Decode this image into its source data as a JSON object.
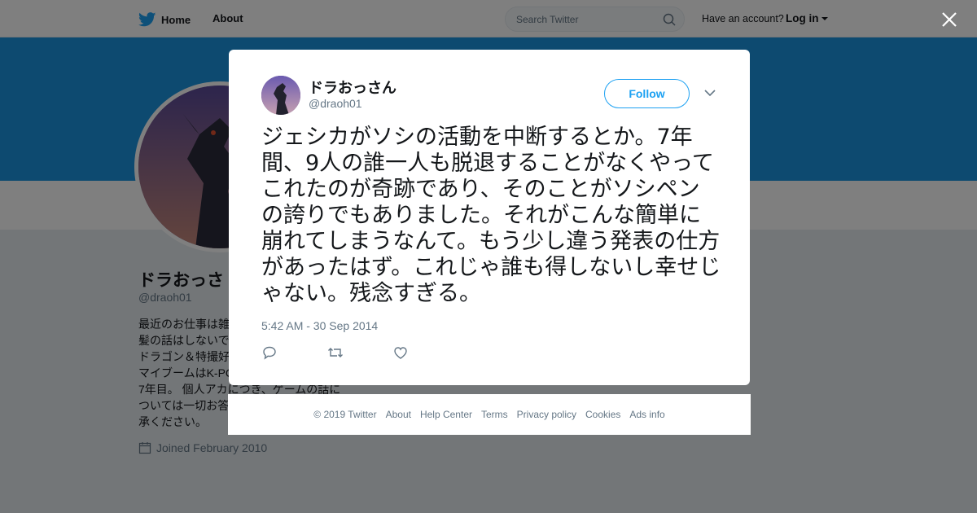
{
  "nav": {
    "home_label": "Home",
    "about_label": "About",
    "search_placeholder": "Search Twitter",
    "have_account_label": "Have an account?",
    "login_label": "Log in"
  },
  "profile": {
    "name": "ドラおっさ",
    "handle": "@draoh01",
    "bio": "最近のお仕事は雑\n髪の話はしないで\nドラゴン＆特撮好\nマイブームはK-PC\n7年目。 個人アカにつき、ゲームの話に\nついては一切お答\n承ください。",
    "joined": "Joined February 2010"
  },
  "tweet": {
    "name": "ドラおっさん",
    "handle": "@draoh01",
    "follow_label": "Follow",
    "text": "ジェシカがソシの活動を中断するとか。7年間、9人の誰一人も脱退することがなくやってこれたのが奇跡であり、そのことがソシペンの誇りでもありました。それがこんな簡単に崩れてしまうなんて。もう少し違う発表の仕方があったはず。これじゃ誰も得しないし幸せじゃない。残念すぎる。",
    "timestamp": "5:42 AM - 30 Sep 2014"
  },
  "footer": {
    "copyright": "© 2019 Twitter",
    "about": "About",
    "help": "Help Center",
    "terms": "Terms",
    "privacy": "Privacy policy",
    "cookies": "Cookies",
    "ads": "Ads info"
  },
  "icons": {
    "logo": "twitter-bird-icon",
    "close": "close-icon",
    "search": "search-icon",
    "reply": "reply-icon",
    "retweet": "retweet-icon",
    "like": "heart-icon",
    "more": "chevron-down-icon",
    "calendar": "calendar-icon"
  },
  "colors": {
    "brand": "#1da1f2",
    "banner": "#1b95e0",
    "text": "#14171a",
    "muted": "#657786",
    "background": "#e6ecf0"
  }
}
